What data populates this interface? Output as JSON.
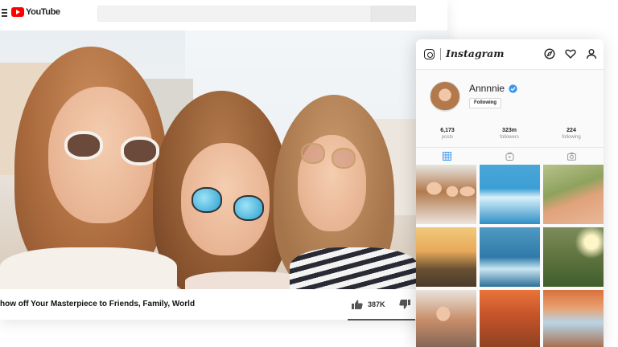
{
  "youtube": {
    "logo_text": "YouTube",
    "search": {
      "placeholder": ""
    },
    "video": {
      "title": "how off Your Masterpiece to Friends, Family, World",
      "likes": "387K",
      "like_ratio": 0.98
    },
    "brand_color": "#ff0000"
  },
  "instagram": {
    "logo_text": "Instagram",
    "header_icons": [
      "compass-icon",
      "heart-icon",
      "user-icon"
    ],
    "profile": {
      "username": "Annnnie",
      "verified": true,
      "follow_button": "Following"
    },
    "stats": [
      {
        "value": "6,173",
        "label": "posts"
      },
      {
        "value": "323m",
        "label": "followers"
      },
      {
        "value": "224",
        "label": "following"
      }
    ],
    "tabs": [
      "grid-icon",
      "tv-icon",
      "tagged-camera-icon"
    ],
    "active_tab": "grid-icon",
    "verified_color": "#3897f0"
  }
}
